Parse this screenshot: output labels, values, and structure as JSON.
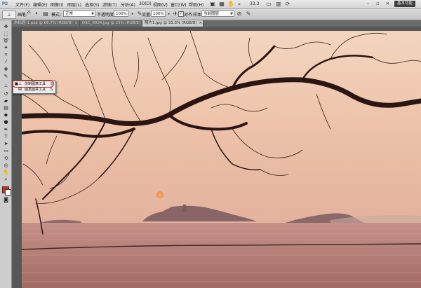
{
  "app": {
    "logo": "PS"
  },
  "menu": {
    "items": [
      "文件(F)",
      "编辑(E)",
      "图像(I)",
      "图层(L)",
      "选择(S)",
      "滤镜(T)",
      "分析(A)",
      "3D(D)",
      "视图(V)",
      "窗口(W)",
      "帮助(H)"
    ],
    "zoom": "33.3",
    "workspace_label": "基本功能"
  },
  "options": {
    "brush_label": "画笔:",
    "brush_size": "21",
    "mode_label": "模式:",
    "mode_value": "正常",
    "opacity_label": "不透明度:",
    "opacity_value": "100%",
    "flow_label": "流量:",
    "flow_value": "100%",
    "aligned_label": "对齐",
    "aligned_checked": true,
    "sample_label": "样本:",
    "sample_value": "当前图层"
  },
  "tabs": [
    {
      "label": "未标题-1.psd @ 66.7% (RGB/8)",
      "active": false
    },
    {
      "label": "DSC_0034.jpg @ 25% (RGB/8)",
      "active": false
    },
    {
      "label": "照片1.jpg @ 33.3% (RGB/8)",
      "active": true
    }
  ],
  "flyout": {
    "items": [
      {
        "icon": "clone-stamp-icon",
        "label": "仿制图章工具",
        "shortcut": "S",
        "selected": true
      },
      {
        "icon": "pattern-stamp-icon",
        "label": "图案图章工具",
        "shortcut": "S",
        "selected": false
      }
    ]
  },
  "colors": {
    "foreground": "#e22b17",
    "background": "#ffffff",
    "highlight": "#d21c1c"
  }
}
